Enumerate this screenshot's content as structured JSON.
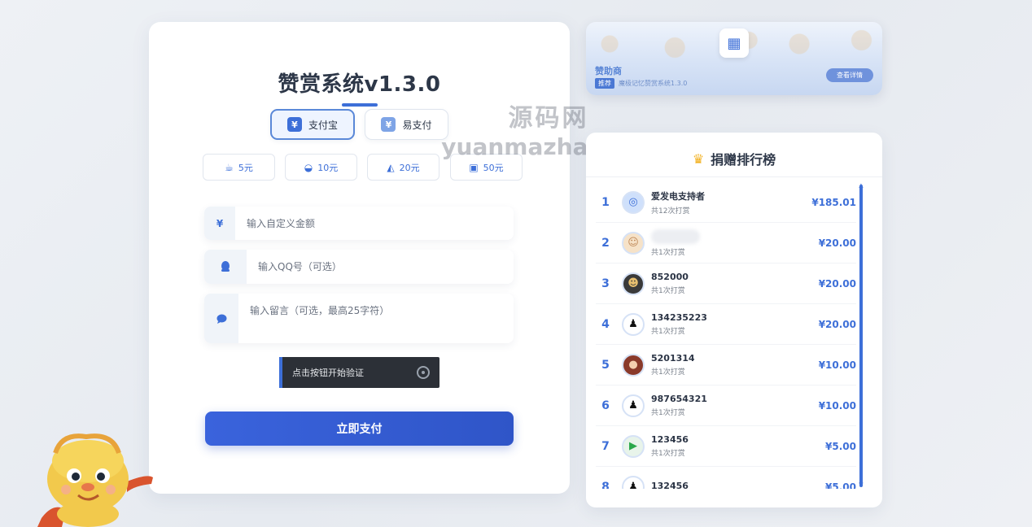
{
  "title": "赞赏系统v1.3.0",
  "pay_methods": [
    {
      "label": "支付宝",
      "icon": "alipay-icon",
      "active": true
    },
    {
      "label": "易支付",
      "icon": "epay-icon",
      "active": false
    }
  ],
  "amounts": [
    {
      "label": "5元",
      "icon": "coffee-icon"
    },
    {
      "label": "10元",
      "icon": "cake-icon"
    },
    {
      "label": "20元",
      "icon": "pizza-icon"
    },
    {
      "label": "50元",
      "icon": "gift-icon"
    }
  ],
  "inputs": {
    "amount_placeholder": "输入自定义金额",
    "amount_symbol": "¥",
    "qq_placeholder": "输入QQ号（可选）",
    "message_placeholder": "输入留言（可选，最高25字符）"
  },
  "captcha_label": "点击按钮开始验证",
  "pay_button": "立即支付",
  "sponsor": {
    "label": "赞助商",
    "tag": "推荐",
    "desc": "魔极记忆赞赏系统1.3.0",
    "button": "查看详情"
  },
  "watermark": {
    "cn": "源码网",
    "en": "yuanmazhan.xyz"
  },
  "ranking": {
    "title": "捐赠排行榜",
    "rows": [
      {
        "rank": "1",
        "name": "爱发电支持者",
        "count": "共12次打赏",
        "amount": "¥185.01"
      },
      {
        "rank": "2",
        "name": "",
        "count": "共1次打赏",
        "amount": "¥20.00"
      },
      {
        "rank": "3",
        "name": "852000",
        "count": "共1次打赏",
        "amount": "¥20.00"
      },
      {
        "rank": "4",
        "name": "134235223",
        "count": "共1次打赏",
        "amount": "¥20.00"
      },
      {
        "rank": "5",
        "name": "5201314",
        "count": "共1次打赏",
        "amount": "¥10.00"
      },
      {
        "rank": "6",
        "name": "987654321",
        "count": "共1次打赏",
        "amount": "¥10.00"
      },
      {
        "rank": "7",
        "name": "123456",
        "count": "共1次打赏",
        "amount": "¥5.00"
      },
      {
        "rank": "8",
        "name": "132456",
        "count": "",
        "amount": "¥5.00"
      }
    ]
  },
  "colors": {
    "accent": "#3d6fd8",
    "captcha_bg": "#2c3037",
    "crown": "#f2b01e"
  }
}
